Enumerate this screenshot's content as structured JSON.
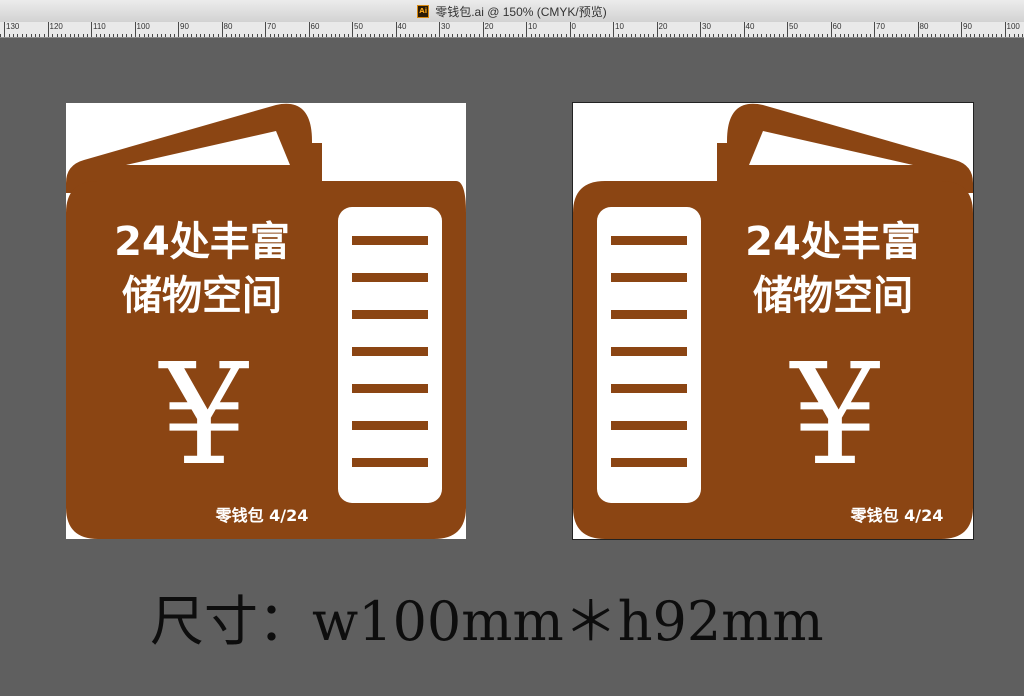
{
  "window": {
    "title": "零钱包.ai @ 150% (CMYK/预览)",
    "file_icon": "illustrator-file-icon",
    "file_icon_text": "Ai"
  },
  "ruler": {
    "labels": [
      "130",
      "120",
      "110",
      "100",
      "90",
      "80",
      "70",
      "60",
      "50",
      "40",
      "30",
      "20",
      "10",
      "0",
      "10",
      "20",
      "30",
      "40",
      "50",
      "60",
      "70",
      "80",
      "90",
      "100"
    ]
  },
  "colors": {
    "brand_brown": "#8b4513",
    "canvas_bg": "#5f5f5f",
    "artboard": "#ffffff"
  },
  "designs": {
    "left": {
      "headline_1": "24处丰富",
      "headline_2": "储物空间",
      "currency_symbol": "¥",
      "footer": "零钱包 4/24"
    },
    "right": {
      "headline_1": "24处丰富",
      "headline_2": "储物空间",
      "currency_symbol": "¥",
      "footer": "零钱包 4/24"
    }
  },
  "caption": "尺寸：w100mm＊h92mm"
}
